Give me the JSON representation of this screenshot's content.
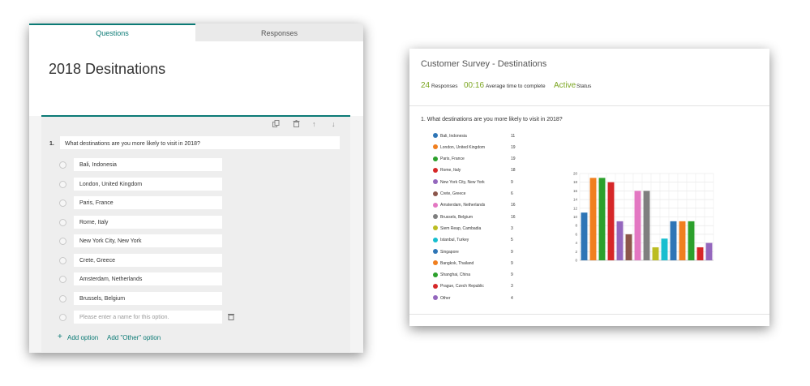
{
  "form": {
    "tabs": [
      {
        "label": "Questions"
      },
      {
        "label": "Responses"
      }
    ],
    "title": "2018 Desitnations",
    "question": {
      "number": "1.",
      "text": "What destinations are you more likely to visit in 2018?",
      "options": [
        "Bali, Indonesia",
        "London, United Kingdom",
        "Paris, France",
        "Rome, Italy",
        "New York City, New York",
        "Crete, Greece",
        "Amsterdam, Netherlands",
        "Brussels, Belgium"
      ],
      "new_option_placeholder": "Please enter a name for this option."
    },
    "add_option_label": "Add option",
    "add_other_label": "Add \"Other\" option",
    "icons": [
      "copy-icon",
      "trash-icon",
      "arrow-up-icon",
      "arrow-down-icon",
      "plus-icon"
    ]
  },
  "summary": {
    "title": "Customer Survey - Destinations",
    "stats": [
      {
        "value": "24",
        "label": "Responses"
      },
      {
        "value": "00:16",
        "label": "Average time to complete"
      },
      {
        "value": "Active",
        "label": "Status"
      }
    ],
    "question": "1.  What destinations are you more likely to visit in 2018?",
    "accent_color": "#7aa51f"
  },
  "chart_data": {
    "type": "bar",
    "categories": [
      "Bali, Indonesia",
      "London, United Kingdom",
      "Paris, France",
      "Rome, Italy",
      "New York City, New York",
      "Crete, Greece",
      "Amsterdam, Netherlands",
      "Brussels, Belgium",
      "Siem Reap, Cambadia",
      "Istanbul, Turkey",
      "Singapore",
      "Bangkok, Thailand",
      "Shanghai, China",
      "Prague, Czech Republic",
      "Other"
    ],
    "values": [
      11,
      19,
      19,
      18,
      9,
      6,
      16,
      16,
      3,
      5,
      9,
      9,
      9,
      3,
      4
    ],
    "colors": [
      "#2e75b6",
      "#f07f1f",
      "#2ca02c",
      "#d62728",
      "#9467bd",
      "#8c564b",
      "#e377c2",
      "#7f7f7f",
      "#bcbd22",
      "#17becf",
      "#2e75b6",
      "#f07f1f",
      "#2ca02c",
      "#d62728",
      "#9467bd"
    ],
    "ylim": [
      0,
      20
    ],
    "yticks": [
      0,
      2,
      4,
      6,
      8,
      10,
      12,
      14,
      16,
      18,
      20
    ],
    "grid": true,
    "legend": "left"
  }
}
